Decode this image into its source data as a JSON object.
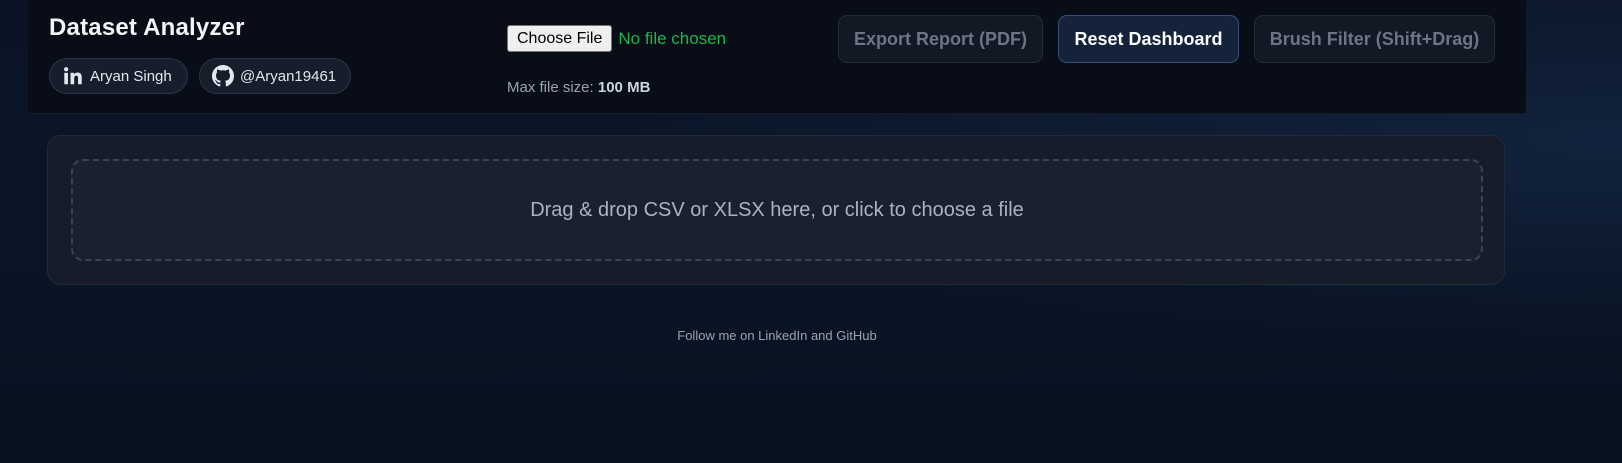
{
  "header": {
    "title": "Dataset Analyzer",
    "social": {
      "linkedin": {
        "label": "Aryan Singh",
        "icon": "linkedin-icon"
      },
      "github": {
        "label": "@Aryan19461",
        "icon": "github-icon"
      }
    },
    "file_input": {
      "button_label": "Choose File",
      "status": "No file chosen"
    },
    "max_size": {
      "label": "Max file size:",
      "value": "100 MB"
    },
    "buttons": {
      "export": "Export Report (PDF)",
      "reset": "Reset Dashboard",
      "brush": "Brush Filter (Shift+Drag)"
    }
  },
  "upload": {
    "dropzone_text": "Drag & drop CSV or XLSX here, or click to choose a file"
  },
  "footer": {
    "text": "Follow me on LinkedIn and GitHub"
  },
  "colors": {
    "background": "#0a1628",
    "header_bg": "#080d18",
    "panel_bg": "#161c2a",
    "file_status": "#22b34a",
    "reset_border": "#34507a"
  }
}
